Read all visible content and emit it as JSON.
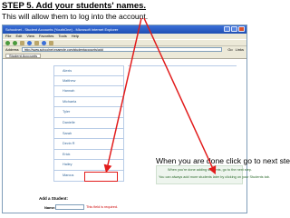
{
  "instructions": {
    "title": "STEP 5. Add your students' names.",
    "subtitle": "This will allow them to log into the account.",
    "callout": "When you are done click go to next step"
  },
  "browser": {
    "window_title": "Schoolnet - Student Accounts (YouthOne) - Microsoft Internet Explorer",
    "menu": [
      "File",
      "Edit",
      "View",
      "Favorites",
      "Tools",
      "Help"
    ],
    "address_label": "Address",
    "address_value": "http://www.schoolnet.example.com/studentaccounts/add",
    "go_label": "Go",
    "links_label": "Links",
    "favorites_tab": "Student Accounts"
  },
  "students": [
    "Alexis",
    "Matthew",
    "Hannah",
    "Michaela",
    "Tyler",
    "Danielle",
    "Sarah",
    "Devin R",
    "Erick",
    "Hailey",
    "Marcus"
  ],
  "add_form": {
    "heading": "Add a Student:",
    "name_label": "Name:",
    "name_value": "",
    "required_note": "This field is required."
  },
  "info_box": {
    "line1": "When you're done adding students, go to the next step.",
    "line2": "You can always add more students later by clicking on your Students tab."
  },
  "colors": {
    "arrow": "#e21b1b",
    "titlebar": "#1f4fb3",
    "info_bg": "#eef5ee"
  }
}
